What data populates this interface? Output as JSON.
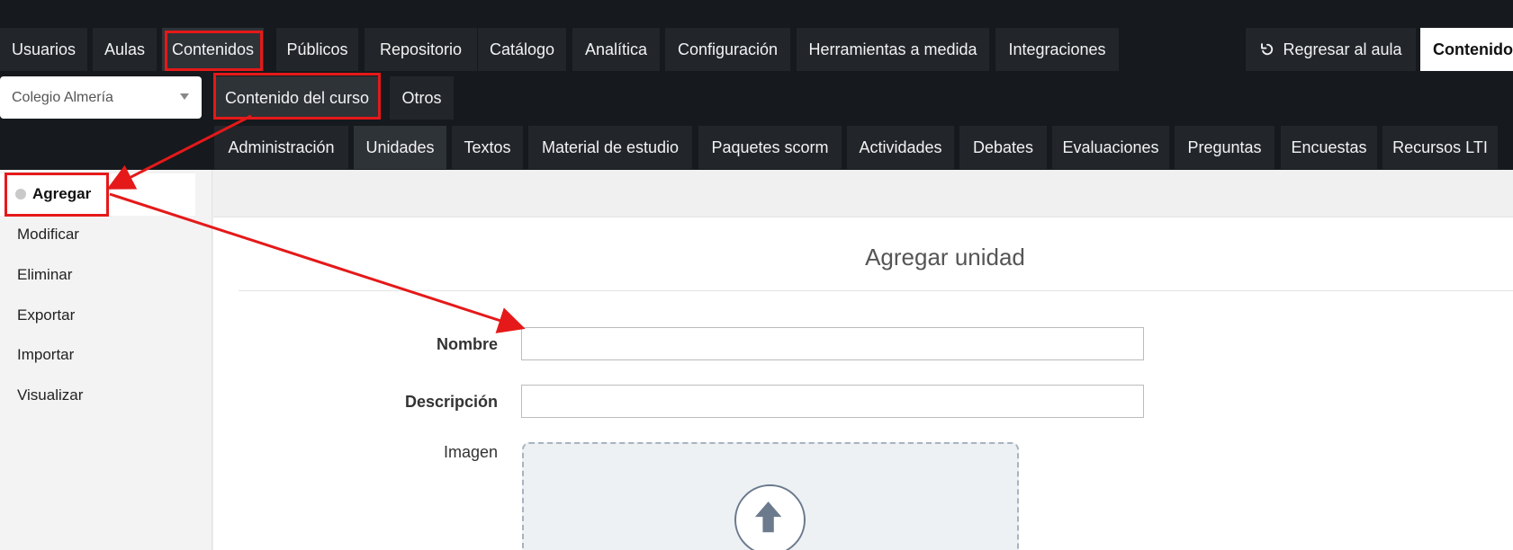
{
  "top_nav": {
    "items": [
      "Usuarios",
      "Aulas",
      "Contenidos",
      "Públicos",
      "Repositorio",
      "Catálogo",
      "Analítica",
      "Configuración",
      "Herramientas a medida",
      "Integraciones"
    ],
    "return_label": "Regresar al aula",
    "right_label": "Contenidos"
  },
  "school_select": {
    "value": "Colegio Almería"
  },
  "second_nav": {
    "items": [
      "Contenido del curso",
      "Otros"
    ]
  },
  "third_nav": {
    "items": [
      "Administración",
      "Unidades",
      "Textos",
      "Material de estudio",
      "Paquetes scorm",
      "Actividades",
      "Debates",
      "Evaluaciones",
      "Preguntas",
      "Encuestas",
      "Recursos LTI"
    ]
  },
  "sidebar": {
    "items": [
      "Agregar",
      "Modificar",
      "Eliminar",
      "Exportar",
      "Importar",
      "Visualizar"
    ]
  },
  "form": {
    "title": "Agregar unidad",
    "name_label": "Nombre",
    "desc_label": "Descripción",
    "image_label": "Imagen",
    "name_value": "",
    "desc_value": ""
  },
  "colors": {
    "nav_bg": "#16191d",
    "button_bg": "#22262b",
    "highlight": "#e51919"
  }
}
